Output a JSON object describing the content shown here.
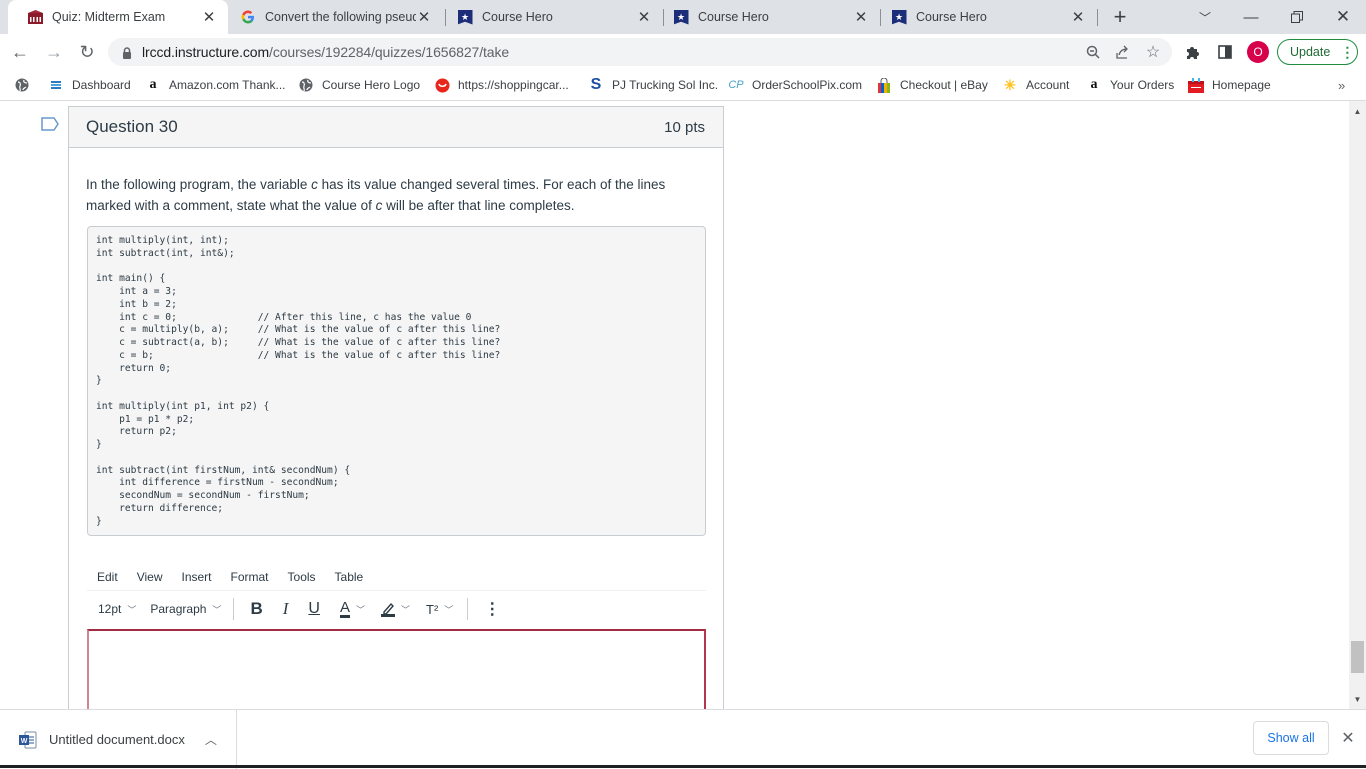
{
  "browser": {
    "tabs": [
      {
        "title": "Quiz: Midterm Exam",
        "icon": "canvas-college-icon",
        "active": true
      },
      {
        "title": "Convert the following pseudo",
        "icon": "google-g-icon",
        "active": false
      },
      {
        "title": "Course Hero",
        "icon": "course-hero-icon",
        "active": false
      },
      {
        "title": "Course Hero",
        "icon": "course-hero-icon",
        "active": false
      },
      {
        "title": "Course Hero",
        "icon": "course-hero-icon",
        "active": false
      }
    ],
    "new_tab_label": "+",
    "url_host": "lrccd.instructure.com",
    "url_path": "/courses/192284/quizzes/1656827/take",
    "profile_initial": "O",
    "update_label": "Update",
    "bookmarks": [
      {
        "label": "",
        "icon": "globe-icon"
      },
      {
        "label": "Dashboard",
        "icon": "dashboard-icon"
      },
      {
        "label": "Amazon.com Thank...",
        "icon": "amazon-icon"
      },
      {
        "label": "Course Hero Logo",
        "icon": "globe-icon"
      },
      {
        "label": "https://shoppingcar...",
        "icon": "shopping-icon"
      },
      {
        "label": "PJ Trucking Sol Inc.",
        "icon": "s-logo-icon"
      },
      {
        "label": "OrderSchoolPix.com",
        "icon": "schoolpix-icon"
      },
      {
        "label": "Checkout | eBay",
        "icon": "shopping-bag-icon"
      },
      {
        "label": "Account",
        "icon": "walmart-spark-icon"
      },
      {
        "label": "Your Orders",
        "icon": "amazon-icon"
      },
      {
        "label": "Homepage",
        "icon": "gift-icon"
      }
    ],
    "bookmarks_overflow": "»"
  },
  "question": {
    "title": "Question 30",
    "points": "10 pts",
    "text_before_c1": "In the following program, the variable ",
    "var_name": "c",
    "text_after_c1": " has its value changed several times. For each of the lines marked with a comment, state what the value of ",
    "text_after_c2": " will be after that line completes.",
    "code_lines": [
      "int multiply(int, int);",
      "int subtract(int, int&);",
      "",
      "int main() {",
      "    int a = 3;",
      "    int b = 2;",
      "    int c = 0;              // After this line, c has the value 0",
      "    c = multiply(b, a);     // What is the value of c after this line?",
      "    c = subtract(a, b);     // What is the value of c after this line?",
      "    c = b;                  // What is the value of c after this line?",
      "    return 0;",
      "}",
      "",
      "int multiply(int p1, int p2) {",
      "    p1 = p1 * p2;",
      "    return p2;",
      "}",
      "",
      "int subtract(int firstNum, int& secondNum) {",
      "    int difference = firstNum - secondNum;",
      "    secondNum = secondNum - firstNum;",
      "    return difference;",
      "}"
    ]
  },
  "editor": {
    "menu": [
      "Edit",
      "View",
      "Insert",
      "Format",
      "Tools",
      "Table"
    ],
    "font_size": "12pt",
    "block_format": "Paragraph",
    "bold": "B",
    "italic": "I",
    "underline": "U",
    "text_color": "A",
    "superscript": "T²",
    "more": "⋮",
    "value": ""
  },
  "downloads": {
    "file_name": "Untitled document.docx",
    "show_all_label": "Show all"
  },
  "colors": {
    "editor_focus_border": "#b5364f",
    "update_green": "#1e8e3e",
    "profile_red": "#d6004b",
    "link_blue": "#1a73e8"
  }
}
